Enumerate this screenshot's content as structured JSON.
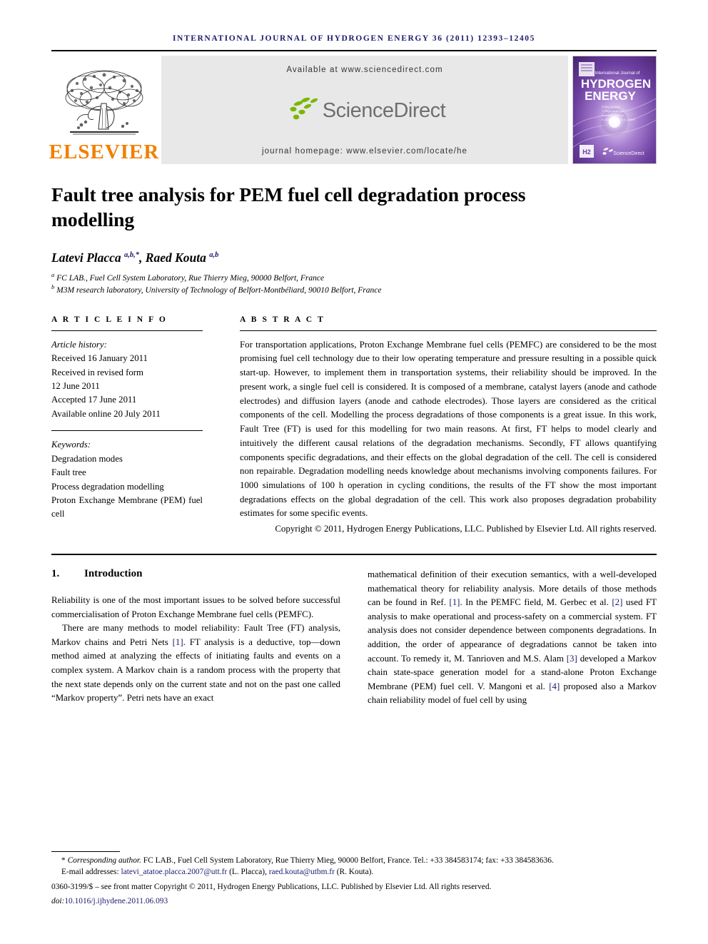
{
  "journal": {
    "running_head": "INTERNATIONAL JOURNAL OF HYDROGEN ENERGY 36 (2011) 12393–12405",
    "publisher_name": "ELSEVIER",
    "publisher_logo_icon": "elsevier-tree-icon",
    "banner": {
      "available_at": "Available at www.sciencedirect.com",
      "sciencedirect_wordmark": "ScienceDirect",
      "sciencedirect_icon": "sciencedirect-leaves-icon",
      "homepage": "journal homepage: www.elsevier.com/locate/he"
    },
    "cover": {
      "line_small": "International Journal of",
      "line_big_1": "HYDROGEN",
      "line_big_2": "ENERGY",
      "badge": "H2",
      "footer_mark": "ScienceDirect"
    },
    "colors": {
      "elsevier_orange": "#F08000",
      "runhead_blue": "#1A1A6E",
      "link_blue": "#1A1A6E",
      "banner_grey": "#E8E8E8",
      "sciencedirect_green": "#7AB800",
      "cover_purple": "#6B3FA0"
    }
  },
  "article": {
    "title": "Fault tree analysis for PEM fuel cell degradation process modelling",
    "authors_html": "Latevi Placca <sup>a,b,*</sup>, Raed Kouta <sup>a,b</sup>",
    "affiliations": [
      {
        "marker": "a",
        "text": "FC LAB., Fuel Cell System Laboratory, Rue Thierry Mieg, 90000 Belfort, France"
      },
      {
        "marker": "b",
        "text": "M3M research laboratory, University of Technology of Belfort-Montbéliard, 90010 Belfort, France"
      }
    ]
  },
  "article_info": {
    "heading": "A R T I C L E  I N F O",
    "history_label": "Article history:",
    "history": [
      "Received 16 January 2011",
      "Received in revised form",
      "12 June 2011",
      "Accepted 17 June 2011",
      "Available online 20 July 2011"
    ],
    "keywords_label": "Keywords:",
    "keywords": [
      "Degradation modes",
      "Fault tree",
      "Process degradation modelling",
      "Proton Exchange Membrane (PEM) fuel cell"
    ]
  },
  "abstract": {
    "heading": "A B S T R A C T",
    "body": "For transportation applications, Proton Exchange Membrane fuel cells (PEMFC) are considered to be the most promising fuel cell technology due to their low operating temperature and pressure resulting in a possible quick start-up. However, to implement them in transportation systems, their reliability should be improved. In the present work, a single fuel cell is considered. It is composed of a membrane, catalyst layers (anode and cathode electrodes) and diffusion layers (anode and cathode electrodes). Those layers are considered as the critical components of the cell. Modelling the process degradations of those components is a great issue. In this work, Fault Tree (FT) is used for this modelling for two main reasons. At first, FT helps to model clearly and intuitively the different causal relations of the degradation mechanisms. Secondly, FT allows quantifying components specific degradations, and their effects on the global degradation of the cell. The cell is considered non repairable. Degradation modelling needs knowledge about mechanisms involving components failures. For 1000 simulations of 100 h operation in cycling conditions, the results of the FT show the most important degradations effects on the global degradation of the cell. This work also proposes degradation probability estimates for some specific events.",
    "copyright": "Copyright © 2011, Hydrogen Energy Publications, LLC. Published by Elsevier Ltd. All rights reserved."
  },
  "body": {
    "section_number": "1.",
    "section_title": "Introduction",
    "left_col": {
      "p1": "Reliability is one of the most important issues to be solved before successful commercialisation of Proton Exchange Membrane fuel cells (PEMFC).",
      "p2_a": "There are many methods to model reliability: Fault Tree (FT) analysis, Markov chains and Petri Nets ",
      "p2_ref1": "[1]",
      "p2_b": ". FT analysis is a deductive, top—down method aimed at analyzing the effects of initiating faults and events on a complex system. A Markov chain is a random process with the property that the next state depends only on the current state and not on the past one called “Markov property”. Petri nets have an exact"
    },
    "right_col": {
      "p1_a": "mathematical definition of their execution semantics, with a well-developed mathematical theory for reliability analysis. More details of those methods can be found in Ref. ",
      "p1_ref1": "[1]",
      "p1_b": ". In the PEMFC field, M. Gerbec et al. ",
      "p1_ref2": "[2]",
      "p1_c": " used FT analysis to make operational and process-safety on a commercial system. FT analysis does not consider dependence between components degradations. In addition, the order of appearance of degradations cannot be taken into account. To remedy it, M. Tanrioven and M.S. Alam ",
      "p1_ref3": "[3]",
      "p1_d": " developed a Markov chain state-space generation model for a stand-alone Proton Exchange Membrane (PEM) fuel cell. V. Mangoni et al. ",
      "p1_ref4": "[4]",
      "p1_e": " proposed also a Markov chain reliability model of fuel cell by using"
    }
  },
  "footer": {
    "corresponding_marker": "*",
    "corresponding_label": "Corresponding author.",
    "corresponding_text": " FC LAB., Fuel Cell System Laboratory, Rue Thierry Mieg, 90000 Belfort, France. Tel.: +33 384583174; fax: +33 384583636.",
    "email_label": "E-mail addresses:",
    "email1": "latevi_atatoe.placca.2007@utt.fr",
    "email1_owner": "(L. Placca)",
    "email2": "raed.kouta@utbm.fr",
    "email2_owner": "(R. Kouta).",
    "issn_line": "0360-3199/$ – see front matter Copyright © 2011, Hydrogen Energy Publications, LLC. Published by Elsevier Ltd. All rights reserved.",
    "doi_label": "doi:",
    "doi_value": "10.1016/j.ijhydene.2011.06.093"
  }
}
